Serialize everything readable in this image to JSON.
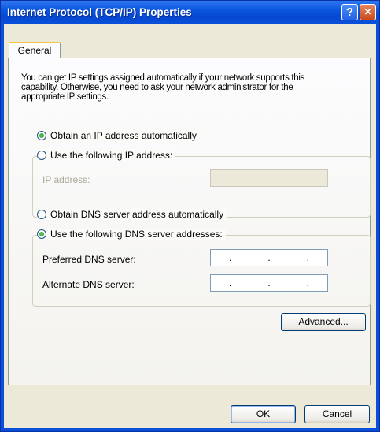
{
  "window": {
    "title": "Internet Protocol (TCP/IP) Properties",
    "help_glyph": "?",
    "close_glyph": "✕"
  },
  "tabs": [
    {
      "label": "General"
    }
  ],
  "description": "You can get IP settings assigned automatically if your network supports this capability. Otherwise, you need to ask your network administrator for the appropriate IP settings.",
  "ip": {
    "auto_label": "Obtain an IP address automatically",
    "auto_selected": true,
    "manual_label": "Use the following IP address:",
    "address_label": "IP address:",
    "address_dots": [
      ".",
      ".",
      "."
    ]
  },
  "dns": {
    "auto_label": "Obtain DNS server address automatically",
    "manual_label": "Use the following DNS server addresses:",
    "manual_selected": true,
    "preferred_label": "Preferred DNS server:",
    "alternate_label": "Alternate DNS server:",
    "dots": [
      ".",
      ".",
      "."
    ]
  },
  "buttons": {
    "advanced": "Advanced...",
    "ok": "OK",
    "cancel": "Cancel"
  },
  "colors": {
    "titlebar": "#0a55de",
    "dialog_bg": "#ece9d8",
    "close_button": "#c84b1d"
  }
}
